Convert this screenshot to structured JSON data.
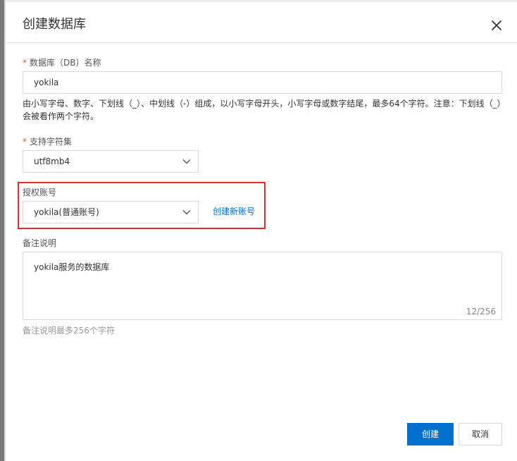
{
  "dialog": {
    "title": "创建数据库"
  },
  "db_name": {
    "required_mark": "*",
    "label": "数据库（DB）名称",
    "value": "yokila",
    "hint": "由小写字母、数字、下划线（_）、中划线（-）组成，以小写字母开头，小写字母或数字结尾，最多64个字符。注意：下划线（_）会被看作两个字符。"
  },
  "charset": {
    "required_mark": "*",
    "label": "支持字符集",
    "value": "utf8mb4"
  },
  "account": {
    "label": "授权账号",
    "value": "yokila(普通账号)",
    "create_link": "创建新账号"
  },
  "remark": {
    "label": "备注说明",
    "value": "yokila服务的数据库",
    "counter": "12/256",
    "hint": "备注说明最多256个字符"
  },
  "footer": {
    "create_label": "创建",
    "cancel_label": "取消"
  },
  "colors": {
    "primary": "#0070cc",
    "highlight_border": "#e52b2b",
    "required": "#e84a3c"
  },
  "icons": {
    "close": "close-icon",
    "select_arrow": "chevron-down-icon"
  }
}
